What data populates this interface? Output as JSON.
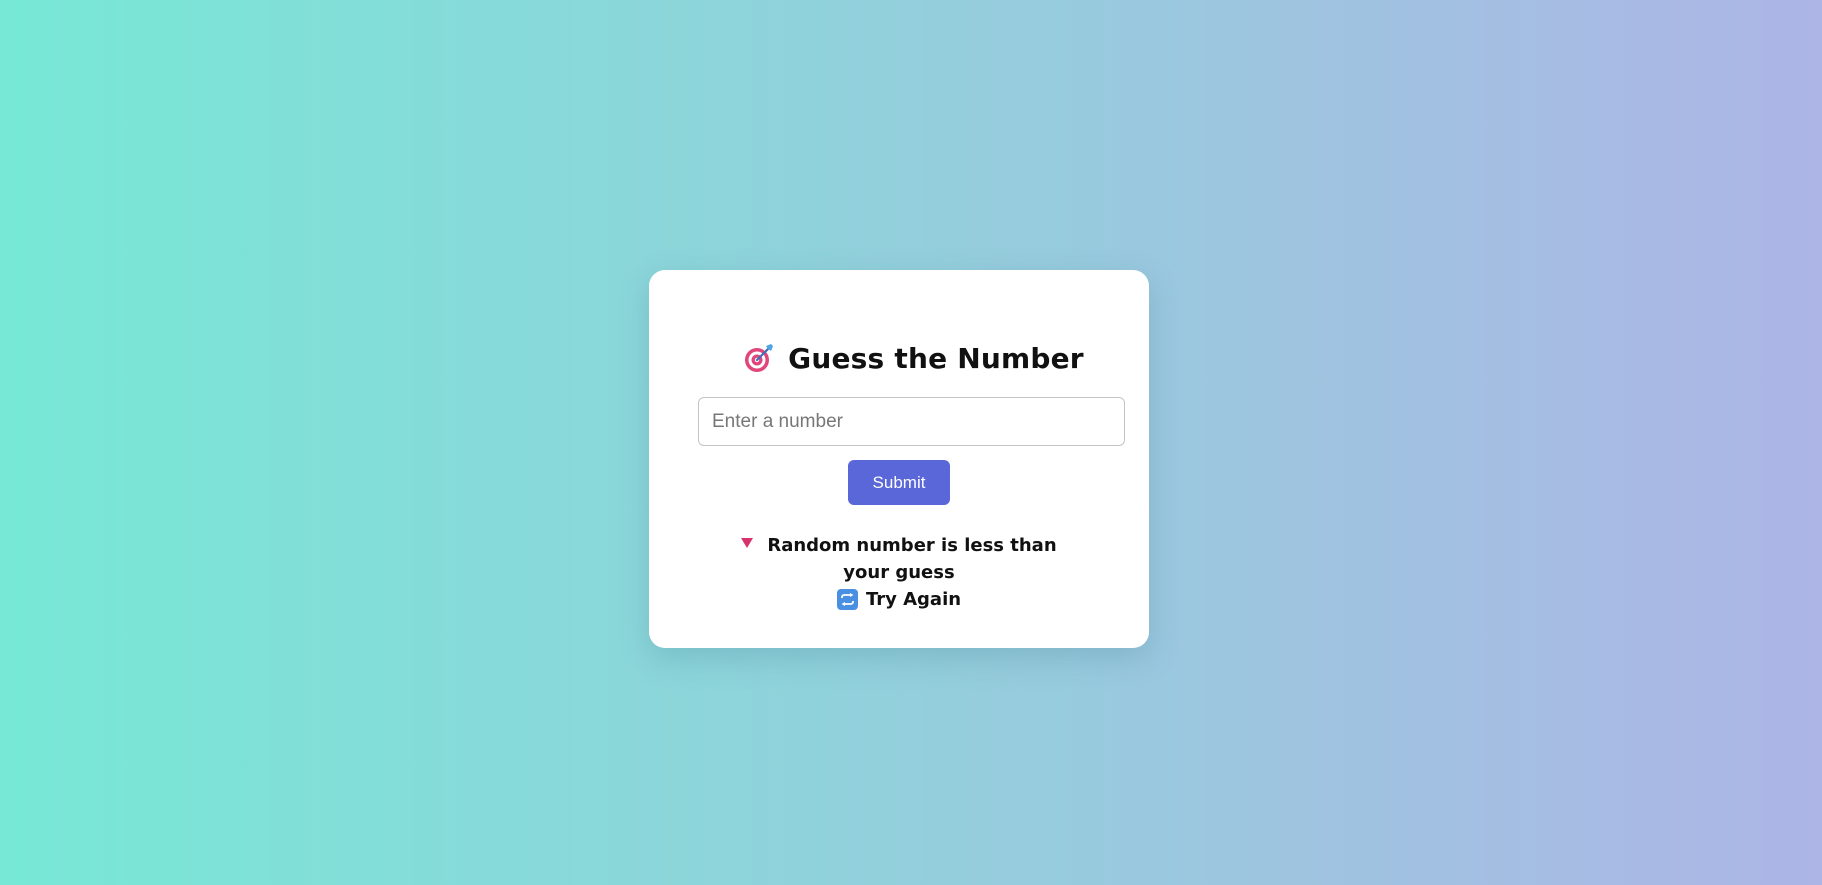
{
  "app": {
    "title": "Guess the Number",
    "title_icon": "target-icon"
  },
  "form": {
    "input_value": "",
    "input_placeholder": "Enter a number",
    "submit_label": "Submit"
  },
  "result": {
    "hint_icon": "down-triangle-icon",
    "hint_text": "Random number is less than your guess",
    "retry_icon": "repeat-icon",
    "retry_text": "Try Again"
  },
  "colors": {
    "background_start": "#77e8d6",
    "background_end": "#adb5e6",
    "card": "#ffffff",
    "button": "#5a67d8",
    "hint_triangle": "#d6336c",
    "retry_icon_bg": "#4a90e2"
  }
}
